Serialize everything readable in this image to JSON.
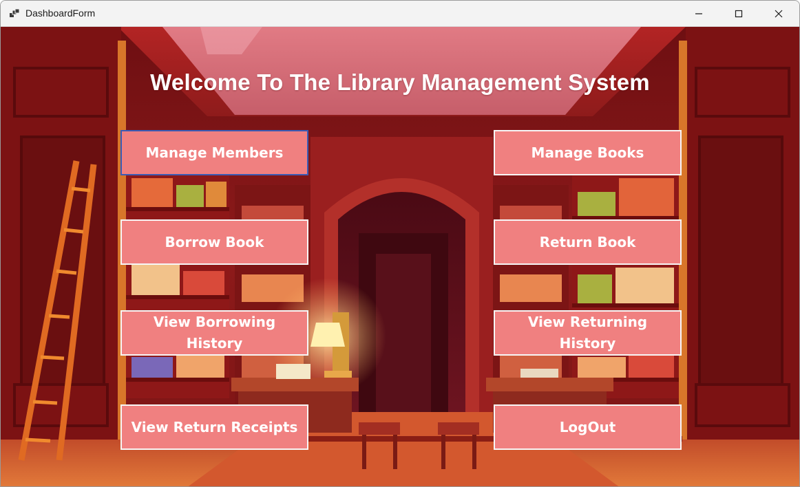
{
  "window": {
    "title": "DashboardForm",
    "controls": [
      "minimize-icon",
      "maximize-icon",
      "close-icon"
    ]
  },
  "header": {
    "title": "Welcome To The Library Management System"
  },
  "buttons": {
    "manage_members": "Manage Members",
    "manage_books": "Manage Books",
    "borrow_book": "Borrow Book",
    "return_book": "Return Book",
    "view_borrowing_history": "View Borrowing History",
    "view_returning_history": "View Returning History",
    "view_return_receipts": "View Return Receipts",
    "logout": "LogOut"
  },
  "colors": {
    "button_fill": "#f08080",
    "button_border": "#f7f7f7",
    "focused_border": "#3b5bb5",
    "background_primary": "#8c1a1a"
  }
}
